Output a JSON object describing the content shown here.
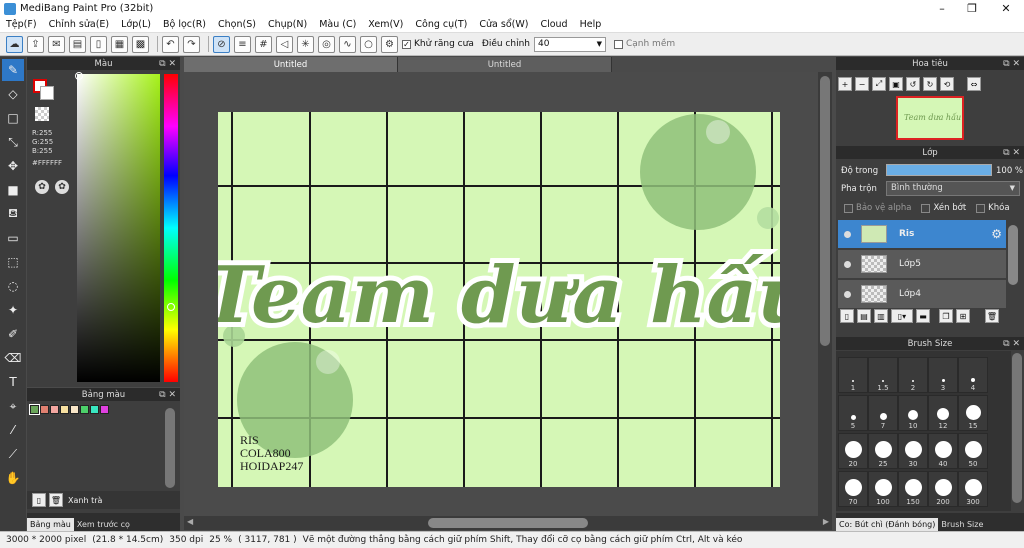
{
  "app": {
    "title": "MediBang Paint Pro (32bit)"
  },
  "window_controls": [
    "–",
    "❐",
    "✕"
  ],
  "menu": [
    "Tệp(F)",
    "Chỉnh sửa(E)",
    "Lớp(L)",
    "Bộ lọc(R)",
    "Chọn(S)",
    "Chụp(N)",
    "Màu (C)",
    "Xem(V)",
    "Công cụ(T)",
    "Cửa sổ(W)",
    "Cloud",
    "Help"
  ],
  "toolbar": {
    "antialias_label": "Khử răng cưa",
    "adjust_label": "Điều chỉnh",
    "adjust_value": "40",
    "edge_label": "Cạnh mềm"
  },
  "tabs": [
    "Untitled",
    "Untitled"
  ],
  "color_panel": {
    "title": "Màu",
    "r": "R:255",
    "g": "G:255",
    "b": "B:255",
    "hex": "#FFFFFF"
  },
  "palette_panel": {
    "title": "Bảng màu",
    "name": "Xanh trà",
    "swatches": [
      "#6aa55a",
      "#e08070",
      "#f3a6a0",
      "#f7e0a0",
      "#f9e6c8",
      "#4cd06a",
      "#39e6c0",
      "#e040e0"
    ]
  },
  "bottom_tabs": {
    "palette": "Bảng màu",
    "brush_preview": "Xem trước cọ"
  },
  "navigator": {
    "title": "Hoa tiêu"
  },
  "layer_panel": {
    "title": "Lớp",
    "opacity_label": "Độ trong",
    "opacity_value": "100 %",
    "blend_label": "Pha trộn",
    "blend_value": "Bình thường",
    "protect_alpha": "Bảo vệ alpha",
    "clipping": "Xén bớt",
    "lock": "Khóa",
    "layers": [
      "Ris",
      "Lớp5",
      "Lớp4"
    ]
  },
  "brush_size": {
    "title": "Brush Size",
    "sizes": [
      "1",
      "1.5",
      "2",
      "3",
      "4",
      "5",
      "7",
      "10",
      "12",
      "15",
      "20",
      "25",
      "30",
      "40",
      "50",
      "70",
      "100",
      "150",
      "200",
      "300"
    ]
  },
  "right_bottom_tabs": {
    "brush": "Co: Bút chì (Đánh bóng)",
    "size": "Brush Size"
  },
  "canvas": {
    "title_text": "Team dưa hấu",
    "credits": [
      "RIS",
      "COLA800",
      "HOIDAP247"
    ]
  },
  "status": {
    "size": "3000 * 2000 pixel",
    "cm": "(21.8 * 14.5cm)",
    "dpi": "350 dpi",
    "zoom": "25 %",
    "coords": "( 3117, 781 )",
    "hint": "Vẽ một đường thẳng bằng cách giữ phím Shift, Thay đổi cỡ cọ bằng cách giữ phím Ctrl, Alt và kéo"
  }
}
